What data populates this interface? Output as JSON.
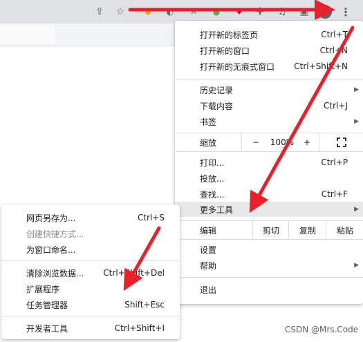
{
  "main_menu": {
    "items": [
      {
        "label": "打开新的标签页",
        "shortcut": "Ctrl+T"
      },
      {
        "label": "打开新的窗口",
        "shortcut": "Ctrl+N"
      },
      {
        "label": "打开新的无痕式窗口",
        "shortcut": "Ctrl+Shift+N"
      },
      {
        "label": "历史记录",
        "shortcut": ""
      },
      {
        "label": "下载内容",
        "shortcut": "Ctrl+J"
      },
      {
        "label": "书签",
        "shortcut": ""
      },
      {
        "label": "打印...",
        "shortcut": "Ctrl+P"
      },
      {
        "label": "投放...",
        "shortcut": ""
      },
      {
        "label": "查找...",
        "shortcut": "Ctrl+F"
      },
      {
        "label": "更多工具",
        "shortcut": ""
      },
      {
        "label": "设置",
        "shortcut": ""
      },
      {
        "label": "帮助",
        "shortcut": ""
      },
      {
        "label": "退出",
        "shortcut": ""
      }
    ],
    "zoom": {
      "label": "缩放",
      "minus": "−",
      "value": "100%",
      "plus": "+"
    },
    "edit": {
      "label": "编辑",
      "cut": "剪切",
      "copy": "复制",
      "paste": "粘贴"
    }
  },
  "sub_menu": {
    "items": [
      {
        "label": "网页另存为...",
        "shortcut": "Ctrl+S"
      },
      {
        "label": "创建快捷方式...",
        "shortcut": ""
      },
      {
        "label": "为窗口命名...",
        "shortcut": ""
      },
      {
        "label": "清除浏览数据...",
        "shortcut": "Ctrl+Shift+Del"
      },
      {
        "label": "扩展程序",
        "shortcut": ""
      },
      {
        "label": "任务管理器",
        "shortcut": "Shift+Esc"
      },
      {
        "label": "开发者工具",
        "shortcut": "Ctrl+Shift+I"
      }
    ]
  },
  "watermark": "CSDN @Mrs.Code",
  "colors": {
    "annotation_arrow": "#e8202a",
    "menu_highlight": "#e8e8e9"
  }
}
